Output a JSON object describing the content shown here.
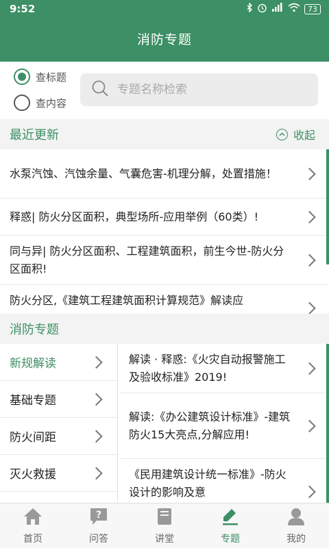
{
  "status": {
    "time": "9:52",
    "battery": "73"
  },
  "header": {
    "title": "消防专题"
  },
  "search": {
    "option_title": "查标题",
    "option_content": "查内容",
    "placeholder": "专题名称检索"
  },
  "recent": {
    "heading": "最近更新",
    "collapse_label": "收起",
    "items": [
      "水泵汽蚀、汽蚀余量、气囊危害-机理分解，处置措施！",
      "释惑| 防火分区面积，典型场所-应用举例（60类）!",
      "同与异| 防火分区面积、工程建筑面积，前生今世-防火分区面积!",
      "防火分区,《建筑工程建筑面积计算规范》解读应"
    ]
  },
  "topics": {
    "heading": "消防专题",
    "categories": [
      "新规解读",
      "基础专题",
      "防火间距",
      "灭火救援"
    ],
    "items": [
      "解读 · 释惑:《火灾自动报警施工及验收标准》2019!",
      "解读:《办公建筑设计标准》-建筑防火15大亮点,分解应用!",
      "《民用建筑设计统一标准》-防火设计的影响及意"
    ]
  },
  "nav": {
    "items": [
      "首页",
      "问答",
      "讲堂",
      "专题",
      "我的"
    ],
    "active": "专题"
  },
  "colors": {
    "accent": "#3d8f65",
    "header_bg": "#3d8f65"
  }
}
